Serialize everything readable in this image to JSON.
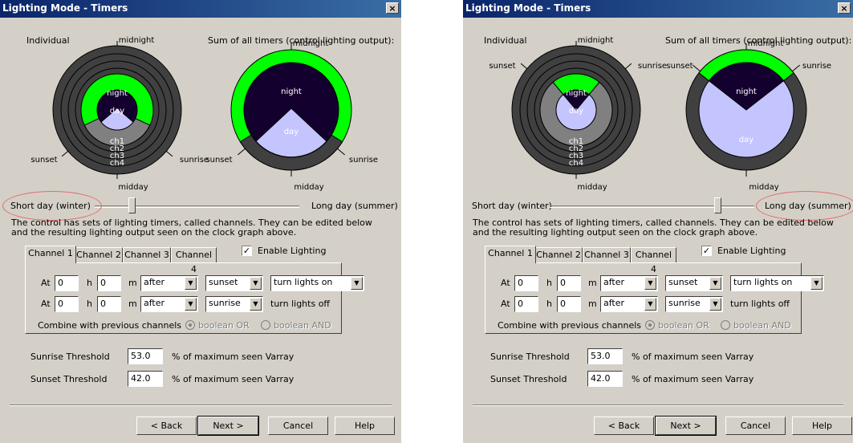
{
  "colors": {
    "titlebar": "#0a246a",
    "night": "#14002e",
    "day": "#c4c4ff",
    "green": "#00ff00",
    "ring": "#404040",
    "ringgray": "#808080",
    "annotation": "#e36c6c"
  },
  "windows": [
    {
      "title": "Lighting Mode - Timers",
      "close": "×",
      "individual_label": "Individual",
      "sum_label": "Sum of all timers (control lighting output):",
      "clock_labels": {
        "midnight": "midnight",
        "midday": "midday",
        "sunset": "sunset",
        "sunrise": "sunrise",
        "night": "night",
        "day": "day",
        "ch1": "ch1",
        "ch2": "ch2",
        "ch3": "ch3",
        "ch4": "ch4"
      },
      "slider": {
        "left_label": "Short day (winter)",
        "right_label": "Long day (summer)",
        "position": 0.18
      },
      "highlight": "left",
      "description": "The control has sets of lighting timers, called channels.  They can be edited below and the resulting  lighting output seen on the clock graph above.",
      "tabs": [
        "Channel 1",
        "Channel 2",
        "Channel 3",
        "Channel 4"
      ],
      "active_tab": 0,
      "enable_lighting": {
        "label": "Enable Lighting",
        "checked": "✓"
      },
      "rows": [
        {
          "at": "At",
          "h_value": "0",
          "h": "h",
          "m_value": "0",
          "m": "m",
          "when": "after",
          "event": "sunset",
          "action": "turn lights on"
        },
        {
          "at": "At",
          "h_value": "0",
          "h": "h",
          "m_value": "0",
          "m": "m",
          "when": "after",
          "event": "sunrise",
          "action": "turn lights off"
        }
      ],
      "combine_label": "Combine with previous channels",
      "radio_or": "boolean OR",
      "radio_and": "boolean AND",
      "sunrise_threshold": {
        "label": "Sunrise Threshold",
        "value": "53.0",
        "unit": "% of maximum seen Varray"
      },
      "sunset_threshold": {
        "label": "Sunset Threshold",
        "value": "42.0",
        "unit": "% of maximum seen Varray"
      },
      "buttons": [
        "< Back",
        "Next >",
        "Cancel",
        "Help"
      ]
    },
    {
      "title": "Lighting Mode - Timers",
      "close": "×",
      "individual_label": "Individual",
      "sum_label": "Sum of all timers (control lighting output):",
      "clock_labels": {
        "midnight": "midnight",
        "midday": "midday",
        "sunset": "sunset",
        "sunrise": "sunrise",
        "night": "night",
        "day": "day",
        "ch1": "ch1",
        "ch2": "ch2",
        "ch3": "ch3",
        "ch4": "ch4"
      },
      "slider": {
        "left_label": "Short day (winter)",
        "right_label": "Long day (summer)",
        "position": 0.82
      },
      "highlight": "right",
      "description": "The control has sets of lighting timers, called channels.  They can be edited below and the resulting  lighting output seen on the clock graph above.",
      "tabs": [
        "Channel 1",
        "Channel 2",
        "Channel 3",
        "Channel 4"
      ],
      "active_tab": 0,
      "enable_lighting": {
        "label": "Enable Lighting",
        "checked": "✓"
      },
      "rows": [
        {
          "at": "At",
          "h_value": "0",
          "h": "h",
          "m_value": "0",
          "m": "m",
          "when": "after",
          "event": "sunset",
          "action": "turn lights on"
        },
        {
          "at": "At",
          "h_value": "0",
          "h": "h",
          "m_value": "0",
          "m": "m",
          "when": "after",
          "event": "sunrise",
          "action": "turn lights off"
        }
      ],
      "combine_label": "Combine with previous channels",
      "radio_or": "boolean OR",
      "radio_and": "boolean AND",
      "sunrise_threshold": {
        "label": "Sunrise Threshold",
        "value": "53.0",
        "unit": "% of maximum seen Varray"
      },
      "sunset_threshold": {
        "label": "Sunset Threshold",
        "value": "42.0",
        "unit": "% of maximum seen Varray"
      },
      "buttons": [
        "< Back",
        "Next >",
        "Cancel",
        "Help"
      ]
    }
  ]
}
